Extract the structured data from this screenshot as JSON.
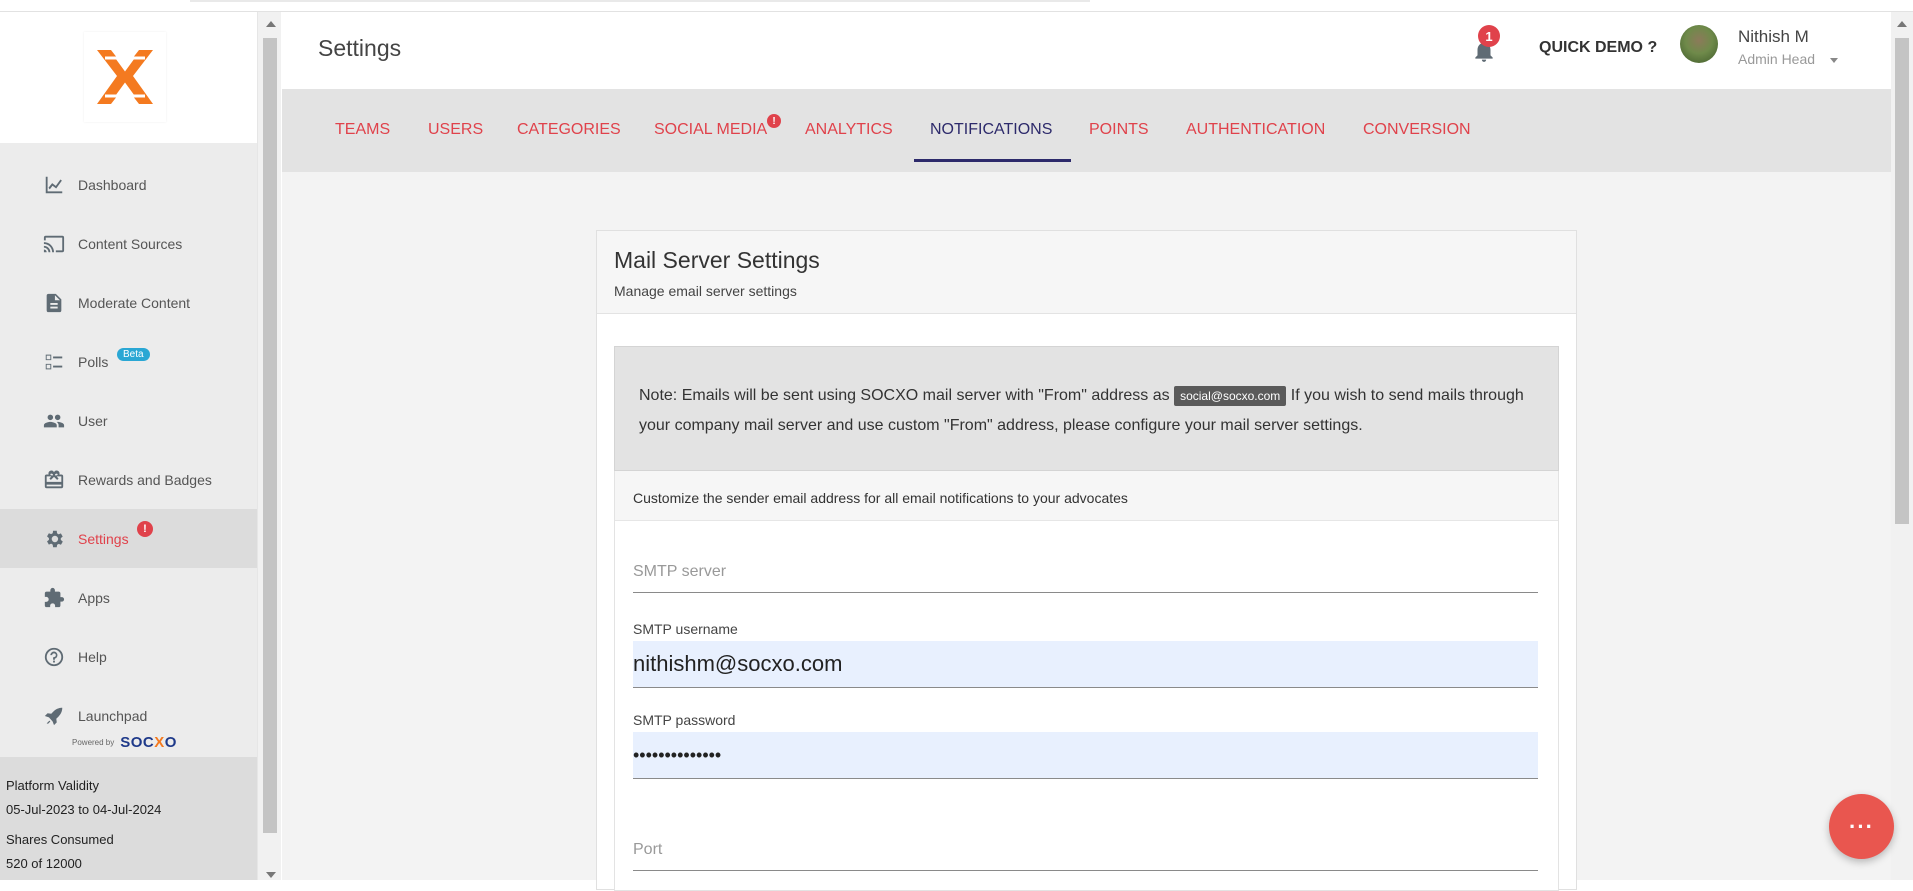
{
  "app": {
    "page_title": "Settings",
    "notifications_count": "1",
    "quick_demo_label": "QUICK DEMO ?",
    "user": {
      "name": "Nithish M",
      "role": "Admin Head"
    }
  },
  "sidebar": {
    "items": [
      {
        "label": "Dashboard",
        "icon": "chart-line-icon"
      },
      {
        "label": "Content Sources",
        "icon": "cast-icon"
      },
      {
        "label": "Moderate Content",
        "icon": "document-icon"
      },
      {
        "label": "Polls",
        "icon": "poll-list-icon",
        "badge": "Beta"
      },
      {
        "label": "User",
        "icon": "people-icon"
      },
      {
        "label": "Rewards and Badges",
        "icon": "gift-card-icon"
      },
      {
        "label": "Settings",
        "icon": "gear-icon",
        "alert": "!",
        "active": true
      },
      {
        "label": "Apps",
        "icon": "puzzle-icon"
      },
      {
        "label": "Help",
        "icon": "help-circle-icon"
      },
      {
        "label": "Launchpad",
        "icon": "rocket-icon"
      }
    ],
    "powered_by": "Powered by",
    "brand_left": "SOC",
    "brand_x": "X",
    "brand_right": "O",
    "validity_label": "Platform Validity",
    "validity_value": "05-Jul-2023 to 04-Jul-2024",
    "shares_label": "Shares Consumed",
    "shares_value": "520 of 12000"
  },
  "tabs": [
    {
      "label": "TEAMS"
    },
    {
      "label": "USERS"
    },
    {
      "label": "CATEGORIES"
    },
    {
      "label": "SOCIAL MEDIA",
      "alert": "!"
    },
    {
      "label": "ANALYTICS"
    },
    {
      "label": "NOTIFICATIONS",
      "active": true
    },
    {
      "label": "POINTS"
    },
    {
      "label": "AUTHENTICATION"
    },
    {
      "label": "CONVERSION"
    }
  ],
  "mail": {
    "title": "Mail Server Settings",
    "subtitle": "Manage email server settings",
    "note_before": "Note: Emails will be sent using SOCXO mail server with \"From\" address as",
    "note_chip": "social@socxo.com",
    "note_after": "If you wish to send mails through your company mail server and use custom \"From\" address, please configure your mail server settings.",
    "section_header": "Customize the sender email address for all email notifications to your advocates",
    "fields": {
      "smtp_server": {
        "placeholder": "SMTP server",
        "value": ""
      },
      "smtp_username": {
        "label": "SMTP username",
        "value": "nithishm@socxo.com"
      },
      "smtp_password": {
        "label": "SMTP password",
        "value": "••••••••••••••"
      },
      "port": {
        "placeholder": "Port"
      }
    }
  },
  "fab_label": "···",
  "colors": {
    "accent": "#e0424b",
    "active_tab": "#2d2a6b",
    "logo_orange": "#f47a20",
    "badge_blue": "#2aa7d4"
  }
}
